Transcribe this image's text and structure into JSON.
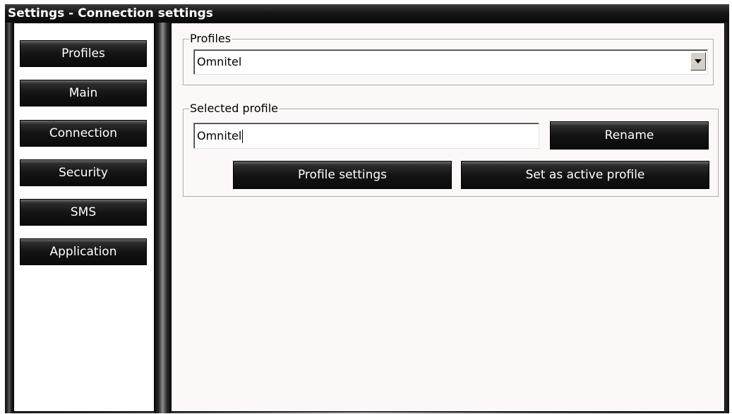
{
  "window": {
    "title": "Settings - Connection settings"
  },
  "sidebar": {
    "items": [
      {
        "label": "Profiles"
      },
      {
        "label": "Main"
      },
      {
        "label": "Connection"
      },
      {
        "label": "Security"
      },
      {
        "label": "SMS"
      },
      {
        "label": "Application"
      }
    ]
  },
  "profiles_group": {
    "legend": "Profiles",
    "selected_value": "Omnitel"
  },
  "selected_profile_group": {
    "legend": "Selected profile",
    "name_value": "Omnitel",
    "rename_label": "Rename",
    "profile_settings_label": "Profile settings",
    "set_active_label": "Set as active profile"
  },
  "icons": {
    "dropdown": "chevron-down-icon"
  }
}
